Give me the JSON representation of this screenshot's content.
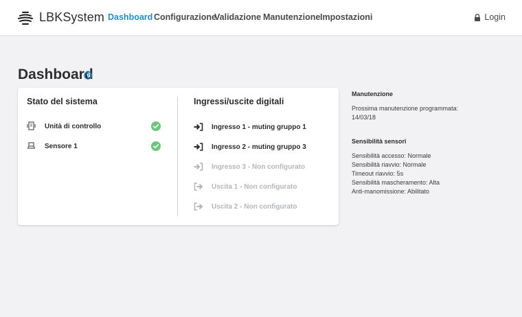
{
  "header": {
    "brand": "LBKSystem",
    "nav": [
      {
        "label": "Dashboard",
        "active": true
      },
      {
        "label": "Configurazione",
        "active": false
      },
      {
        "label": "Validazione",
        "active": false
      },
      {
        "label": "Manutenzione",
        "active": false
      },
      {
        "label": "Impostazioni",
        "active": false
      }
    ],
    "login_label": "Login",
    "login_icon": "lock-icon"
  },
  "page": {
    "title": "Dashboard",
    "help_icon": "help-circle-icon"
  },
  "system_status": {
    "heading": "Stato del sistema",
    "devices": [
      {
        "label": "Unità di controllo",
        "icon": "control-unit-icon",
        "status": "ok"
      },
      {
        "label": "Sensore 1",
        "icon": "sensor-icon",
        "status": "ok"
      }
    ]
  },
  "digital_io": {
    "heading": "Ingressi/uscite digitali",
    "items": [
      {
        "label": "Ingresso 1 - muting gruppo 1",
        "type": "input",
        "configured": true
      },
      {
        "label": "Ingresso 2 - muting gruppo 3",
        "type": "input",
        "configured": true
      },
      {
        "label": "Ingresso 3 - Non configurato",
        "type": "input",
        "configured": false
      },
      {
        "label": "Uscita 1 - Non configurato",
        "type": "output",
        "configured": false
      },
      {
        "label": "Uscita 2 - Non configurato",
        "type": "output",
        "configured": false
      }
    ]
  },
  "maintenance": {
    "heading": "Manutenzione",
    "lines": [
      "Prossima manutenzione programmata:",
      "14/03/18"
    ]
  },
  "sensor_sensitivity": {
    "heading": "Sensibilità sensori",
    "lines": [
      "Sensibilità accesso: Normale",
      "Sensibilità riavvio: Normale",
      "Timeout riavvio: 5s",
      "Sensibilità mascheramento: Alta",
      "Anti-manomissione: Abilitato"
    ]
  },
  "colors": {
    "accent": "#1f8fc8",
    "ok_green": "#6cc77c",
    "disabled_text": "#b4b6ba",
    "background": "#f2f2f4"
  }
}
